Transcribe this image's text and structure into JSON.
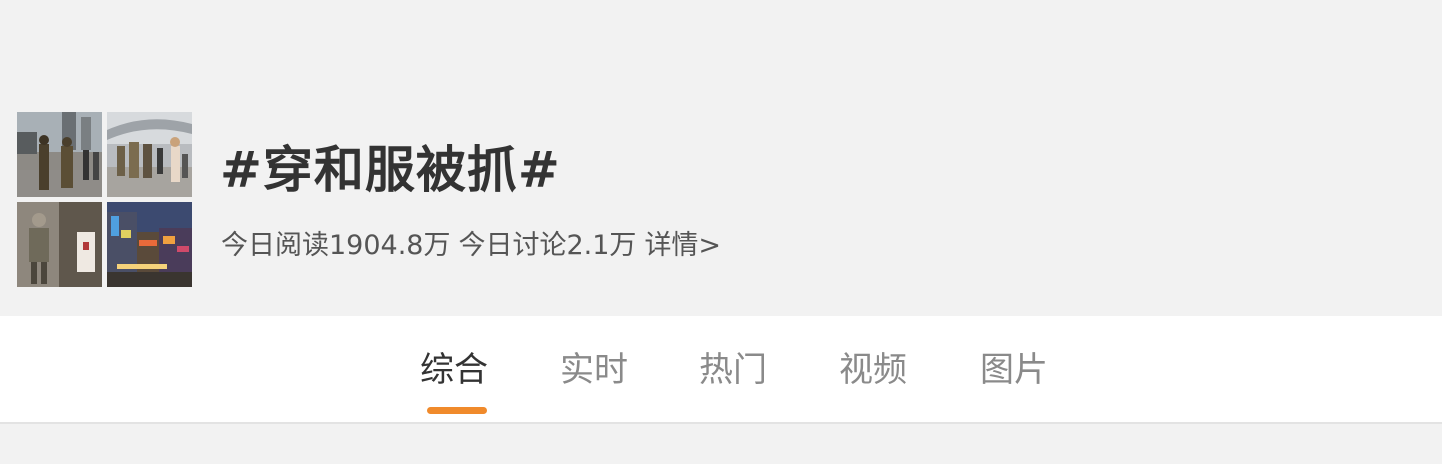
{
  "topic": {
    "title": "#穿和服被抓#",
    "stats": {
      "read_today": "今日阅读1904.8万",
      "discuss_today": "今日讨论2.1万",
      "details_link": "详情>"
    },
    "thumbnails": [
      "soldiers-street-photo",
      "crowd-costume-photo",
      "soldier-portrait-photo",
      "night-street-photo"
    ]
  },
  "tabs": [
    {
      "label": "综合",
      "active": true
    },
    {
      "label": "实时",
      "active": false
    },
    {
      "label": "热门",
      "active": false
    },
    {
      "label": "视频",
      "active": false
    },
    {
      "label": "图片",
      "active": false
    }
  ],
  "colors": {
    "accent": "#f08a2b",
    "header_bg": "#f2f2f2",
    "title": "#333333",
    "tab_inactive": "#8a8a8a"
  }
}
